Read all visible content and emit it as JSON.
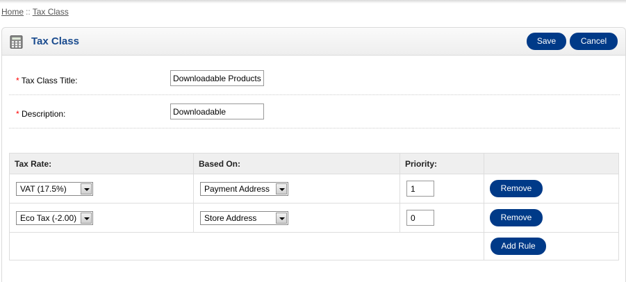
{
  "breadcrumb": {
    "home": "Home",
    "separator": "::",
    "current": "Tax Class"
  },
  "heading": {
    "icon": "calculator-icon",
    "title": "Tax Class",
    "save_label": "Save",
    "cancel_label": "Cancel"
  },
  "form": {
    "required_marker": "*",
    "title_label": "Tax Class Title:",
    "title_value": "Downloadable Products",
    "description_label": "Description:",
    "description_value": "Downloadable"
  },
  "rates_table": {
    "headers": {
      "tax_rate": "Tax Rate:",
      "based_on": "Based On:",
      "priority": "Priority:"
    },
    "rows": [
      {
        "tax_rate": "VAT (17.5%)",
        "based_on": "Payment Address",
        "priority": "1",
        "remove_label": "Remove"
      },
      {
        "tax_rate": "Eco Tax (-2.00)",
        "based_on": "Store Address",
        "priority": "0",
        "remove_label": "Remove"
      }
    ],
    "add_rule_label": "Add Rule"
  },
  "colors": {
    "button_bg": "#003a88",
    "title_color": "#1a4b8e",
    "required_color": "#ff0000"
  }
}
